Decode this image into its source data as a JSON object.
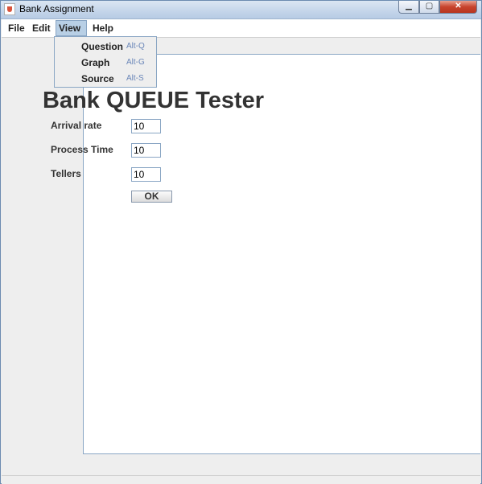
{
  "window": {
    "title": "Bank Assignment"
  },
  "menubar": {
    "file": "File",
    "edit": "Edit",
    "view": "View",
    "help": "Help"
  },
  "view_menu": {
    "items": [
      {
        "label": "Question",
        "accelerator": "Alt-Q"
      },
      {
        "label": "Graph",
        "accelerator": "Alt-G"
      },
      {
        "label": "Source",
        "accelerator": "Alt-S"
      }
    ]
  },
  "main": {
    "heading": "Bank QUEUE Tester",
    "fields": [
      {
        "label": "Arrival rate",
        "value": "10"
      },
      {
        "label": "Process Time",
        "value": "10"
      },
      {
        "label": "Tellers",
        "value": "10"
      }
    ],
    "ok_label": "OK"
  },
  "colors": {
    "menu_highlight": "#b8cfe5",
    "accelerator_text": "#6a86b8",
    "border_accent": "#8aa6c4"
  }
}
